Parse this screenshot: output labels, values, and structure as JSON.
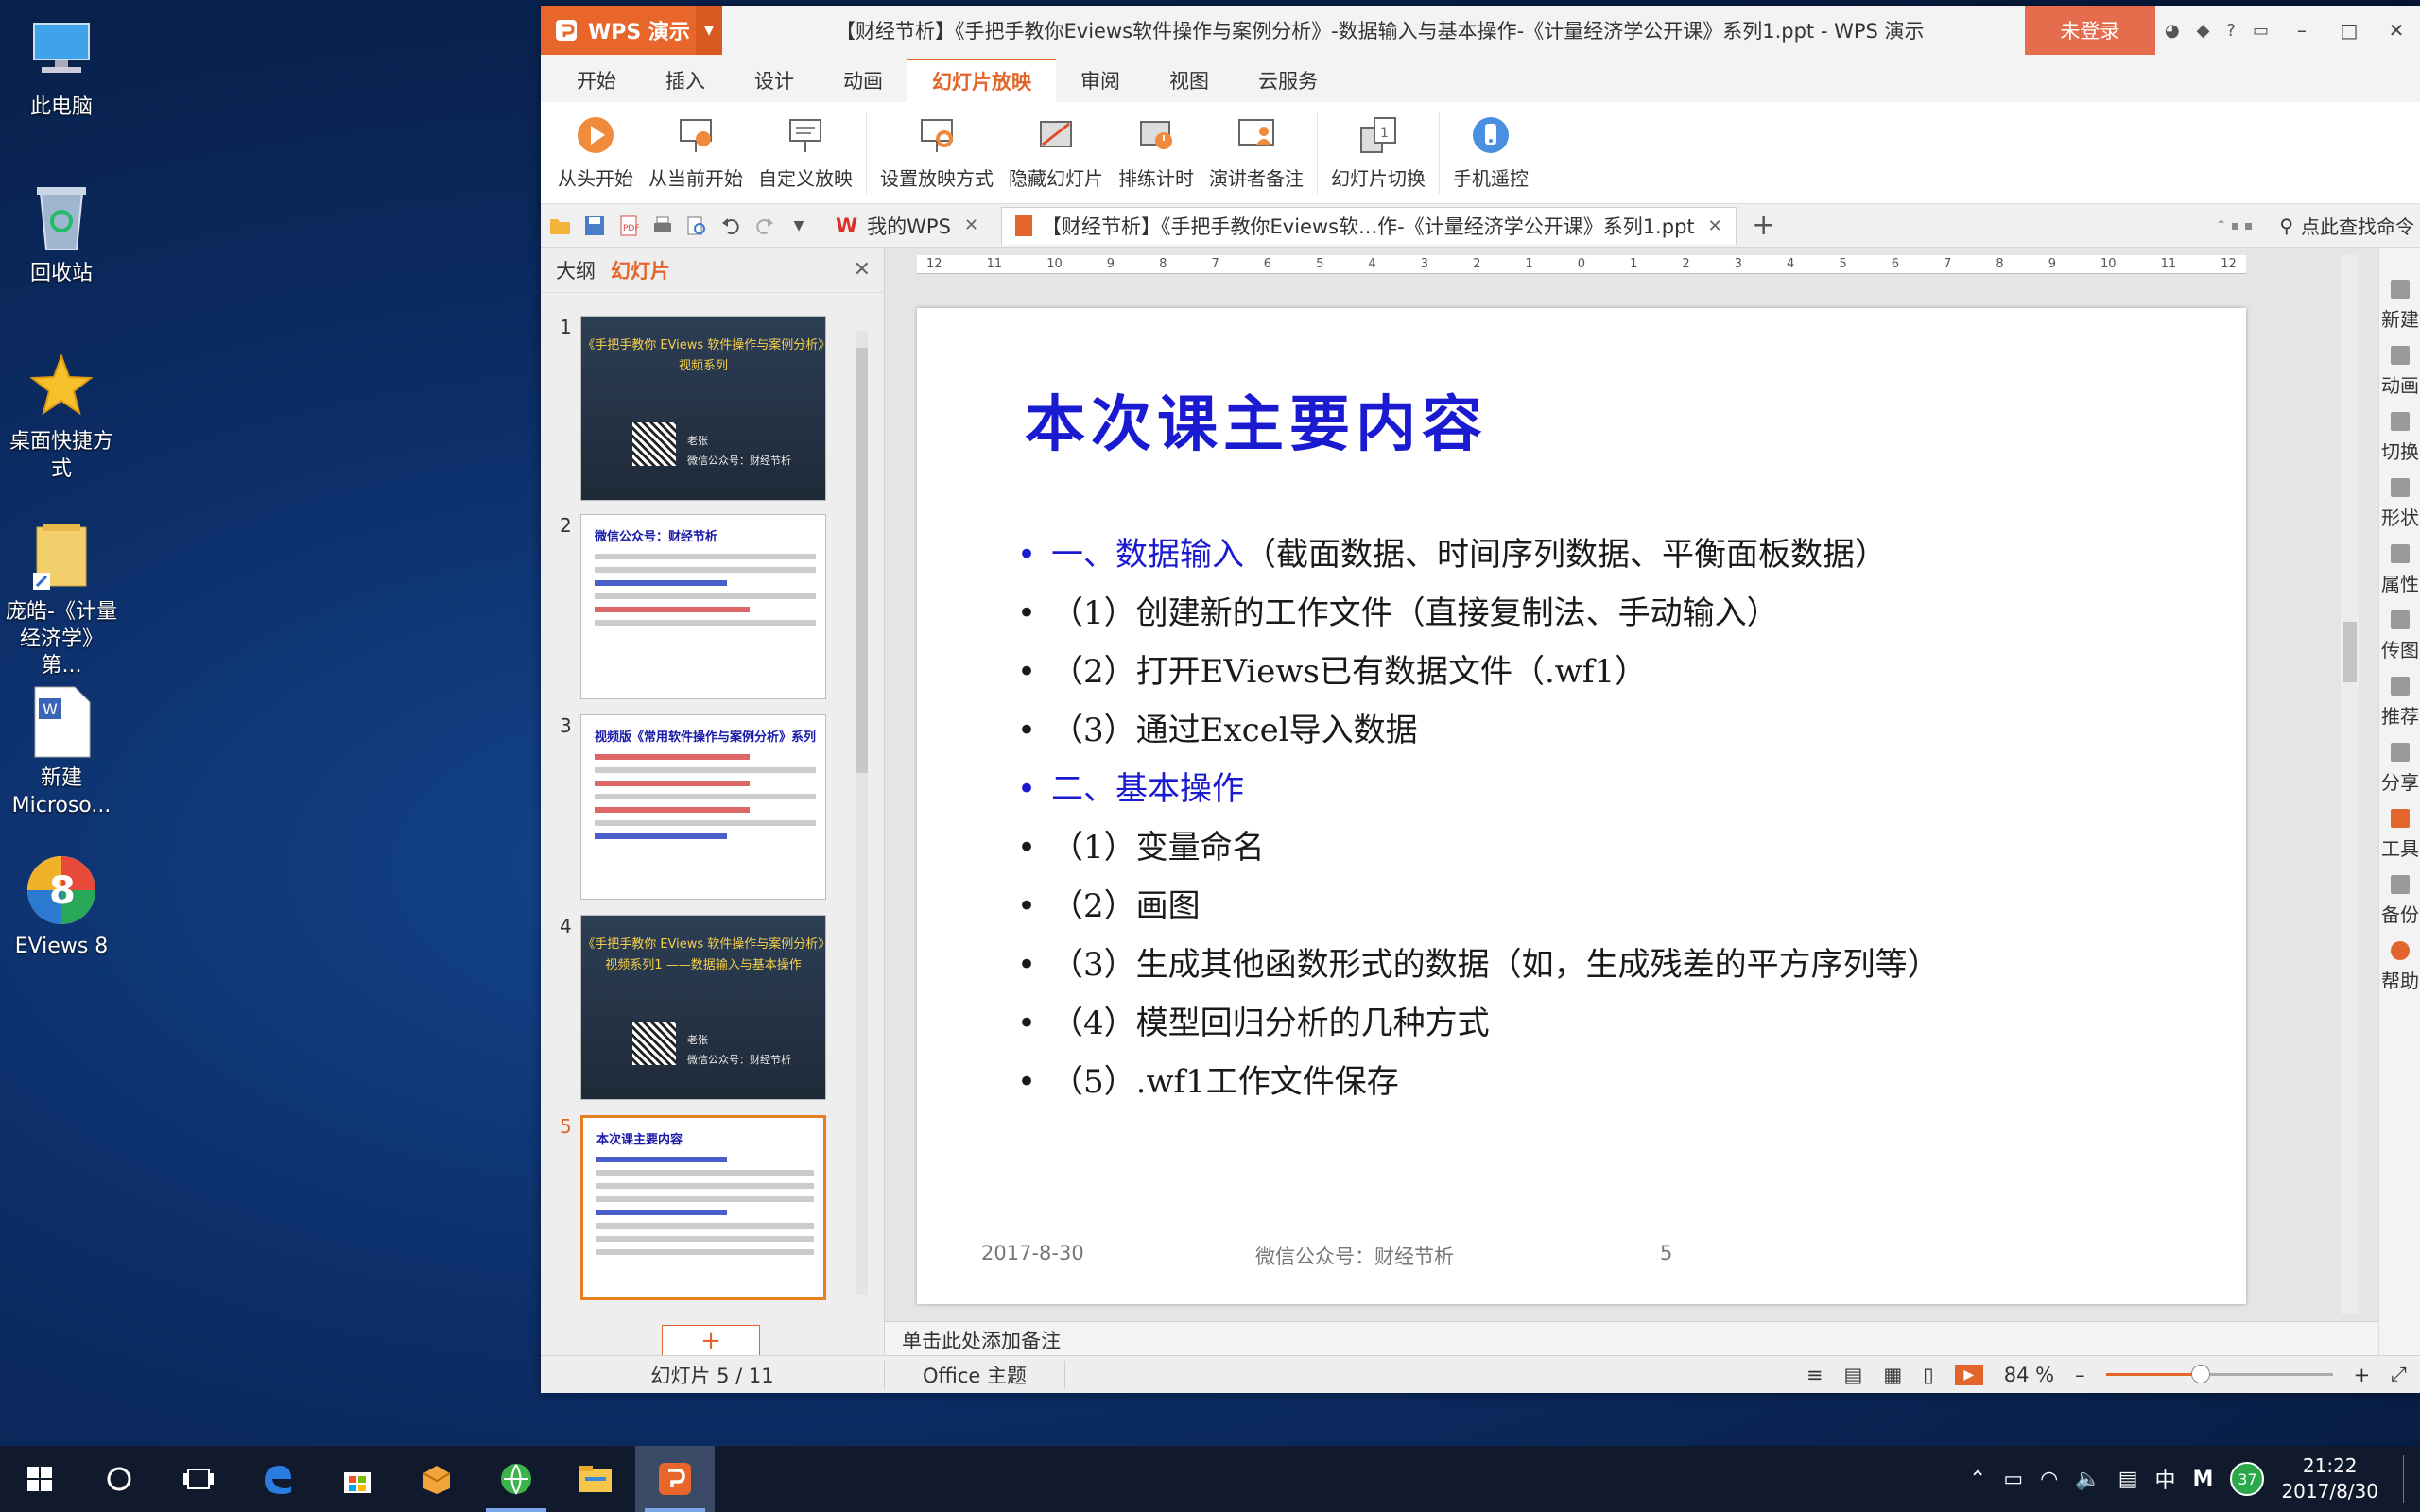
{
  "desktop": {
    "icons": [
      {
        "label": "此电脑"
      },
      {
        "label": "回收站"
      },
      {
        "label": "桌面快捷方式"
      },
      {
        "label": "庞皓-《计量经济学》第..."
      },
      {
        "label": "新建 Microso..."
      },
      {
        "label": "EViews 8"
      }
    ]
  },
  "window": {
    "app_name": "WPS 演示",
    "title": "【财经节析】《手把手教你Eviews软件操作与案例分析》-数据输入与基本操作-《计量经济学公开课》系列1.ppt - WPS 演示",
    "login_label": "未登录"
  },
  "menu": [
    "开始",
    "插入",
    "设计",
    "动画",
    "幻灯片放映",
    "审阅",
    "视图",
    "云服务"
  ],
  "menu_active": "幻灯片放映",
  "ribbon": [
    "从头开始",
    "从当前开始",
    "自定义放映",
    "设置放映方式",
    "隐藏幻灯片",
    "排练计时",
    "演讲者备注",
    "幻灯片切换",
    "手机遥控"
  ],
  "tabs": {
    "my_wps": "我的WPS",
    "doc": "【财经节析】《手把手教你Eviews软...作-《计量经济学公开课》系列1.ppt",
    "search": "点此查找命令"
  },
  "panel": {
    "tab_outline": "大纲",
    "tab_slides": "幻灯片",
    "thumbs": [
      {
        "num": "1",
        "title": "《手把手教你 EViews 软件操作与案例分析》视频系列",
        "meta1": "老张",
        "meta2": "微信公众号：财经节析"
      },
      {
        "num": "2",
        "title": "微信公众号：财经节析"
      },
      {
        "num": "3",
        "title": "视频版《常用软件操作与案例分析》系列"
      },
      {
        "num": "4",
        "title": "《手把手教你 EViews 软件操作与案例分析》视频系列1 ——数据输入与基本操作",
        "meta1": "老张",
        "meta2": "微信公众号：财经节析"
      },
      {
        "num": "5",
        "title": "本次课主要内容"
      }
    ]
  },
  "ruler_labels": [
    "12",
    "11",
    "10",
    "9",
    "8",
    "7",
    "6",
    "5",
    "4",
    "3",
    "2",
    "1",
    "0",
    "1",
    "2",
    "3",
    "4",
    "5",
    "6",
    "7",
    "8",
    "9",
    "10",
    "11",
    "12"
  ],
  "slide": {
    "title": "本次课主要内容",
    "items": [
      {
        "dot": "•",
        "head": "一、数据输入",
        "rest": "（截面数据、时间序列数据、平衡面板数据）",
        "kind": "head"
      },
      {
        "dot": "•",
        "text": "（1）创建新的工作文件（直接复制法、手动输入）"
      },
      {
        "dot": "•",
        "text": "（2）打开EViews已有数据文件（.wf1）"
      },
      {
        "dot": "•",
        "text": "（3）通过Excel导入数据"
      },
      {
        "dot": "•",
        "head": "二、基本操作",
        "rest": "",
        "kind": "head"
      },
      {
        "dot": "•",
        "text": "（1）变量命名"
      },
      {
        "dot": "•",
        "text": "（2）画图"
      },
      {
        "dot": "•",
        "text": "（3）生成其他函数形式的数据（如，生成残差的平方序列等）"
      },
      {
        "dot": "•",
        "text": "（4）模型回归分析的几种方式"
      },
      {
        "dot": "•",
        "text": "（5）.wf1工作文件保存"
      }
    ],
    "footer_date": "2017-8-30",
    "footer_center": "微信公众号：财经节析",
    "footer_page": "5"
  },
  "notes_placeholder": "单击此处添加备注",
  "rightbar": [
    "新建",
    "动画",
    "切换",
    "形状",
    "属性",
    "传图",
    "推荐",
    "分享",
    "工具",
    "备份",
    "帮助"
  ],
  "status": {
    "slide_info": "幻灯片 5 / 11",
    "theme": "Office 主题",
    "zoom": "84 %",
    "zoom_fraction": 0.84
  },
  "taskbar": {
    "ime": "中",
    "badge": "37",
    "time": "21:22",
    "date": "2017/8/30"
  },
  "colors": {
    "accent": "#e2662c",
    "slide_blue": "#1a1ad0",
    "taskbar": "#101a2c"
  }
}
